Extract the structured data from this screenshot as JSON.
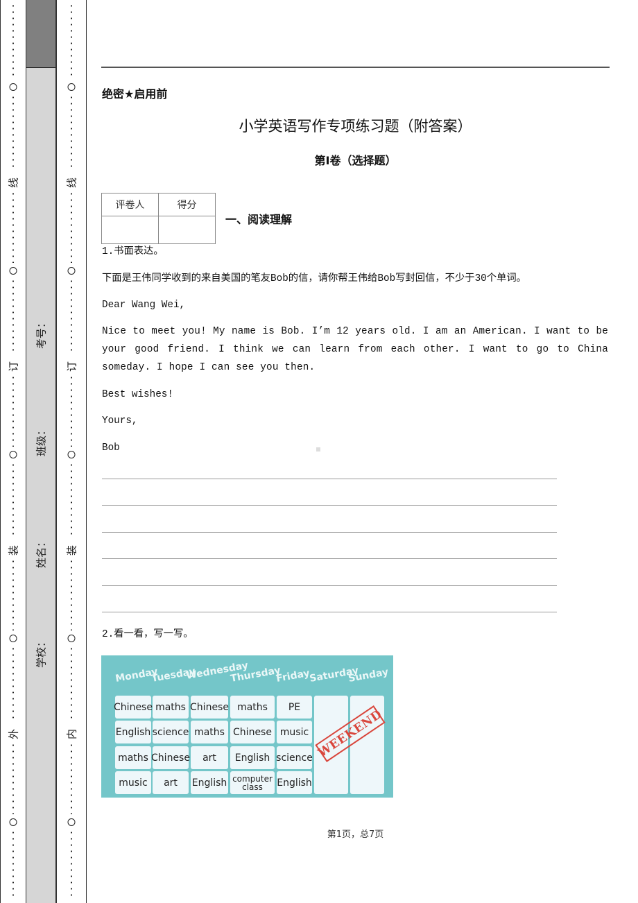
{
  "binding_margin": {
    "outer_marks": [
      "线",
      "订",
      "装",
      "外"
    ],
    "inner_marks": [
      "线",
      "订",
      "装",
      "内"
    ],
    "fields": [
      {
        "label": "考号："
      },
      {
        "label": "班级："
      },
      {
        "label": "姓名："
      },
      {
        "label": "学校："
      }
    ]
  },
  "header": {
    "secret_label": "绝密★启用前",
    "title": "小学英语写作专项练习题（附答案）",
    "volume": "第I卷（选择题）"
  },
  "grader_table": {
    "col1": "评卷人",
    "col2": "得分"
  },
  "section": {
    "heading": "一、阅读理解"
  },
  "question1": {
    "number_title": "1.书面表达。",
    "instruction": "下面是王伟同学收到的来自美国的笔友Bob的信，请你帮王伟给Bob写封回信，不少于30个单词。",
    "letter": {
      "greeting": "Dear Wang Wei,",
      "body": "Nice to meet you! My name is Bob. I’m 12 years old. I am an American. I want to be your good friend. I think we can learn from each other. I want to go to China someday. I hope I can see you then.",
      "closing1": "Best wishes!",
      "closing2": "Yours,",
      "signature": "Bob"
    },
    "answer_line_count": 6
  },
  "question2": {
    "number_title": "2.看一看，写一写。",
    "timetable": {
      "days": [
        "Monday",
        "Tuesday",
        "Wednesday",
        "Thursday",
        "Friday",
        "Saturday",
        "Sunday"
      ],
      "rows": [
        [
          "Chinese",
          "maths",
          "Chinese",
          "maths",
          "PE"
        ],
        [
          "English",
          "science",
          "maths",
          "Chinese",
          "music"
        ],
        [
          "maths",
          "Chinese",
          "art",
          "English",
          "science"
        ],
        [
          "music",
          "art",
          "English",
          "computer class",
          "English"
        ]
      ],
      "weekend_stamp": "WEEKEND",
      "colors": {
        "background": "#74c6c9",
        "cell": "#eef7fa",
        "stamp": "#d9463c"
      }
    }
  },
  "footer": {
    "page_info": "第1页，总7页"
  }
}
